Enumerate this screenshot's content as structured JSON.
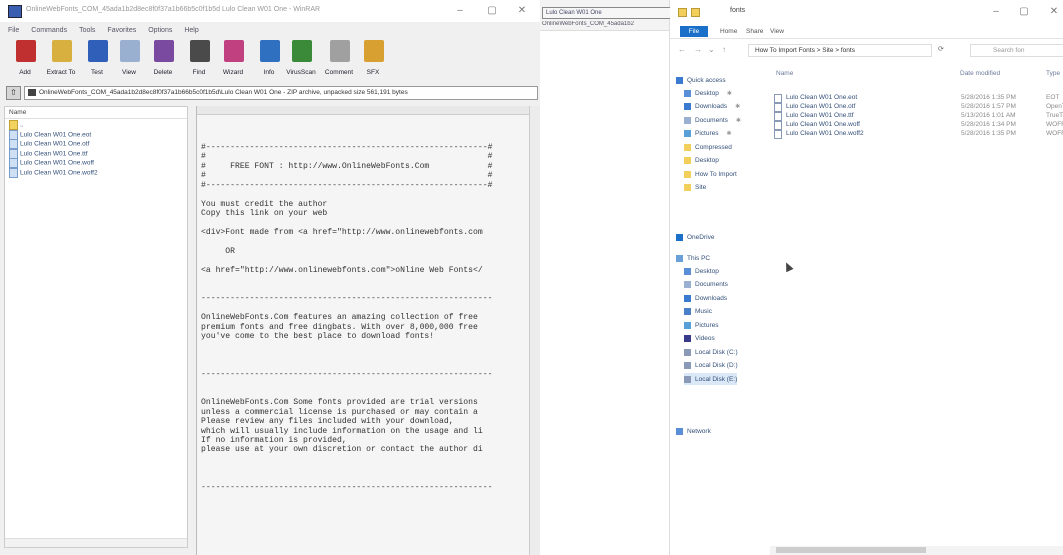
{
  "winrar": {
    "title": "OnlineWebFonts_COM_45ada1b2d8ec8f0f37a1b66b5c0f1b5d Lulo Clean W01 One - WinRAR",
    "menu": [
      "File",
      "Commands",
      "Tools",
      "Favorites",
      "Options",
      "Help"
    ],
    "toolbar": [
      {
        "label": "Add",
        "icon": "add-archive-icon",
        "color": "#c03030"
      },
      {
        "label": "Extract To",
        "icon": "extract-to-icon",
        "color": "#d8b040"
      },
      {
        "label": "Test",
        "icon": "test-icon",
        "color": "#2f5fb8"
      },
      {
        "label": "View",
        "icon": "view-icon",
        "color": "#9ab0d0"
      },
      {
        "label": "Delete",
        "icon": "delete-icon",
        "color": "#7a4aa0"
      },
      {
        "label": "Find",
        "icon": "find-icon",
        "color": "#4a4a4a"
      },
      {
        "label": "Wizard",
        "icon": "wizard-icon",
        "color": "#c04080"
      },
      {
        "label": "Info",
        "icon": "info-icon",
        "color": "#3070c0"
      },
      {
        "label": "VirusScan",
        "icon": "virusscan-icon",
        "color": "#3a8a3a"
      },
      {
        "label": "Comment",
        "icon": "comment-icon",
        "color": "#a0a0a0"
      },
      {
        "label": "SFX",
        "icon": "sfx-icon",
        "color": "#d8a030"
      }
    ],
    "path_text": "OnlineWebFonts_COM_45ada1b2d8ec8f0f37a1b66b5c0f1b5d\\Lulo Clean W01 One - ZIP archive, unpacked size 561,191 bytes",
    "list_header": "Name",
    "files": [
      "..",
      "Lulo Clean W01 One.eot",
      "Lulo Clean W01 One.otf",
      "Lulo Clean W01 One.ttf",
      "Lulo Clean W01 One.woff",
      "Lulo Clean W01 One.woff2"
    ],
    "comment_lines": [
      "",
      "",
      "#----------------------------------------------------------#",
      "#                                                          #",
      "#     FREE FONT : http://www.OnlineWebFonts.Com            #",
      "#                                                          #",
      "#----------------------------------------------------------#",
      "",
      "You must credit the author",
      "Copy this link on your web",
      "",
      "<div>Font made from <a href=\"http://www.onlinewebfonts.com",
      "",
      "     OR",
      "",
      "<a href=\"http://www.onlinewebfonts.com\">oNline Web Fonts</",
      "",
      "",
      "------------------------------------------------------------",
      "",
      "OnlineWebFonts.Com features an amazing collection of free",
      "premium fonts and free dingbats. With over 8,000,000 free",
      "you've come to the best place to download fonts!",
      "",
      "",
      "",
      "------------------------------------------------------------",
      "",
      "",
      "OnlineWebFonts.Com Some fonts provided are trial versions",
      "unless a commercial license is purchased or may contain a",
      "Please review any files included with your download,",
      "which will usually include information on the usage and li",
      "If no information is provided,",
      "please use at your own discretion or contact the author di",
      "",
      "",
      "",
      "------------------------------------------------------------"
    ]
  },
  "middle": {
    "tab": "Lulo Clean W01 One",
    "sub": "OnlineWebFonts_COM_45ada1b2"
  },
  "explorer": {
    "title": "fonts",
    "ribbon": [
      "File",
      "Home",
      "Share",
      "View"
    ],
    "address": "How To Import Fonts  >  Site  >  fonts",
    "search_placeholder": "Search fon",
    "quick_access": "Quick access",
    "nav": [
      {
        "label": "Desktop",
        "pinned": true,
        "color": "#5a8fd8"
      },
      {
        "label": "Downloads",
        "pinned": true,
        "color": "#3a7ad0"
      },
      {
        "label": "Documents",
        "pinned": true,
        "color": "#9ab0d0"
      },
      {
        "label": "Pictures",
        "pinned": true,
        "color": "#5aa0d8"
      },
      {
        "label": "Compressed",
        "pinned": false,
        "color": "#f2cf5a"
      },
      {
        "label": "Desktop",
        "pinned": false,
        "color": "#f2cf5a"
      },
      {
        "label": "How To Import",
        "pinned": false,
        "color": "#f2cf5a"
      },
      {
        "label": "Site",
        "pinned": false,
        "color": "#f2cf5a"
      }
    ],
    "onedrive": "OneDrive",
    "thispc": "This PC",
    "pc_items": [
      {
        "label": "Desktop",
        "color": "#5a8fd8"
      },
      {
        "label": "Documents",
        "color": "#9ab0d0"
      },
      {
        "label": "Downloads",
        "color": "#3a7ad0"
      },
      {
        "label": "Music",
        "color": "#4a80c8"
      },
      {
        "label": "Pictures",
        "color": "#5aa0d8"
      },
      {
        "label": "Videos",
        "color": "#3a3a8a"
      },
      {
        "label": "Local Disk (C:)",
        "color": "#8a9ab6"
      },
      {
        "label": "Local Disk (D:)",
        "color": "#8a9ab6"
      },
      {
        "label": "Local Disk (E:)",
        "color": "#8a9ab6"
      }
    ],
    "network": "Network",
    "columns": {
      "name": "Name",
      "date": "Date modified",
      "type": "Type"
    },
    "files": [
      {
        "name": "Lulo Clean W01 One.eot",
        "date": "5/28/2016 1:35 PM",
        "type": "EOT"
      },
      {
        "name": "Lulo Clean W01 One.otf",
        "date": "5/28/2016 1:57 PM",
        "type": "OpenT"
      },
      {
        "name": "Lulo Clean W01 One.ttf",
        "date": "5/13/2016 1:01 AM",
        "type": "TrueT"
      },
      {
        "name": "Lulo Clean W01 One.woff",
        "date": "5/28/2016 1:34 PM",
        "type": "WOFF"
      },
      {
        "name": "Lulo Clean W01 One.woff2",
        "date": "5/28/2016 1:35 PM",
        "type": "WOFF2"
      }
    ]
  }
}
